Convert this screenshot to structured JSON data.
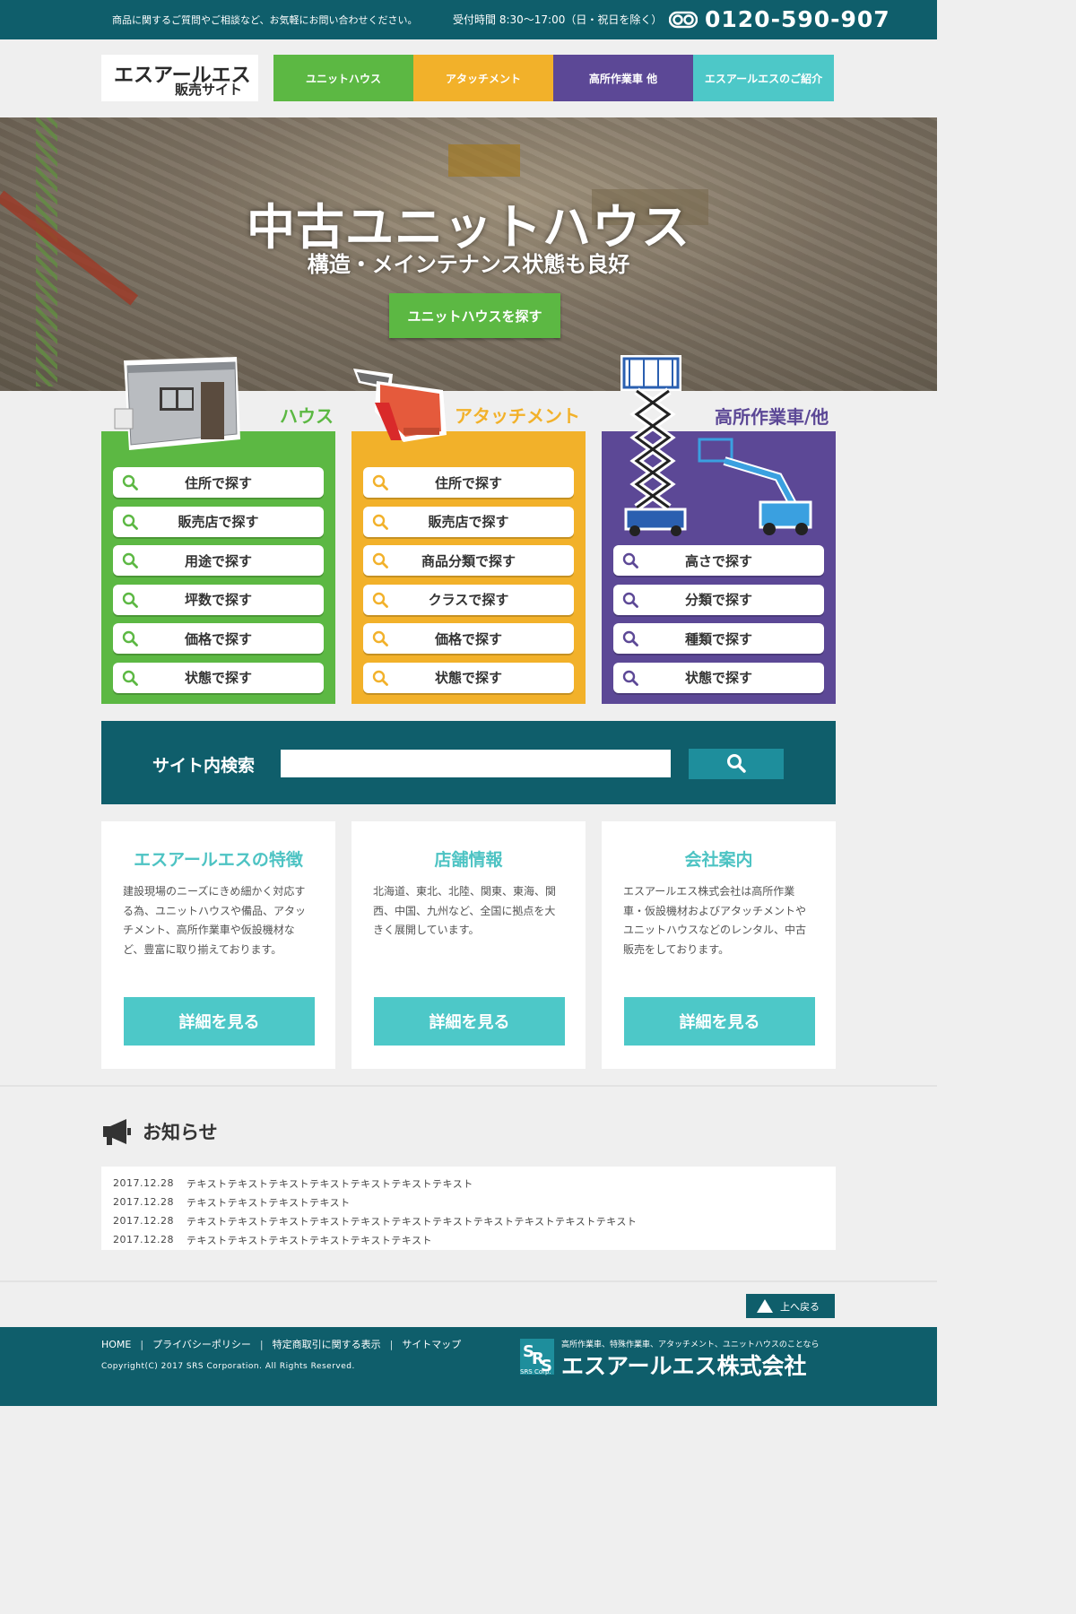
{
  "topbar": {
    "inquiry": "商品に関するご質問やご相談など、お気軽にお問い合わせください。",
    "hours": "受付時間 8:30〜17:00（日・祝日を除く）",
    "phone": "0120-590-907"
  },
  "logo": {
    "line1": "エスアールエス",
    "line2": "販売サイト"
  },
  "gnav": [
    {
      "label": "ユニットハウス",
      "color": "#5cb843"
    },
    {
      "label": "アタッチメント",
      "color": "#f2b12a"
    },
    {
      "label": "高所作業車 他",
      "color": "#5c4896"
    },
    {
      "label": "エスアールエスのご紹介",
      "color": "#4dc8c8"
    }
  ],
  "hero": {
    "title": "中古ユニットハウス",
    "subtitle": "構造・メインテナンス状態も良好",
    "cta": "ユニットハウスを探す"
  },
  "categories": [
    {
      "label": "ハウス",
      "color": "#5cb843",
      "buttons": [
        "住所で探す",
        "販売店で探す",
        "用途で探す",
        "坪数で探す",
        "価格で探す",
        "状態で探す"
      ]
    },
    {
      "label": "アタッチメント",
      "color": "#f2b12a",
      "buttons": [
        "住所で探す",
        "販売店で探す",
        "商品分類で探す",
        "クラスで探す",
        "価格で探す",
        "状態で探す"
      ]
    },
    {
      "label": "高所作業車/他",
      "color": "#5c4896",
      "buttons": [
        "高さで探す",
        "分類で探す",
        "種類で探す",
        "状態で探す"
      ]
    }
  ],
  "search": {
    "label": "サイト内検索",
    "value": ""
  },
  "info": [
    {
      "title": "エスアールエスの特徴",
      "text": "建設現場のニーズにきめ細かく対応する為、ユニットハウスや備品、アタッチメント、高所作業車や仮設機材など、豊富に取り揃えております。",
      "more": "詳細を見る"
    },
    {
      "title": "店舗情報",
      "text": "北海道、東北、北陸、関東、東海、関西、中国、九州など、全国に拠点を大きく展開しています。",
      "more": "詳細を見る"
    },
    {
      "title": "会社案内",
      "text": "エスアールエス株式会社は高所作業車・仮設機材およびアタッチメントやユニットハウスなどのレンタル、中古販売をしております。",
      "more": "詳細を見る"
    }
  ],
  "news": {
    "heading": "お知らせ",
    "items": [
      {
        "date": "2017.12.28",
        "text": "テキストテキストテキストテキストテキストテキストテキスト"
      },
      {
        "date": "2017.12.28",
        "text": "テキストテキストテキストテキスト"
      },
      {
        "date": "2017.12.28",
        "text": "テキストテキストテキストテキストテキストテキストテキストテキストテキストテキストテキスト"
      },
      {
        "date": "2017.12.28",
        "text": "テキストテキストテキストテキストテキストテキスト"
      }
    ]
  },
  "totop": "上へ戻る",
  "footer": {
    "nav": [
      "HOME",
      "プライバシーポリシー",
      "特定商取引に関する表示",
      "サイトマップ"
    ],
    "copyright": "Copyright(C) 2017 SRS Corporation. All Rights Reserved.",
    "tagline": "高所作業車、特殊作業車、アタッチメント、ユニットハウスのことなら",
    "company": "エスアールエス株式会社",
    "logo_text": "SRS Corp."
  }
}
